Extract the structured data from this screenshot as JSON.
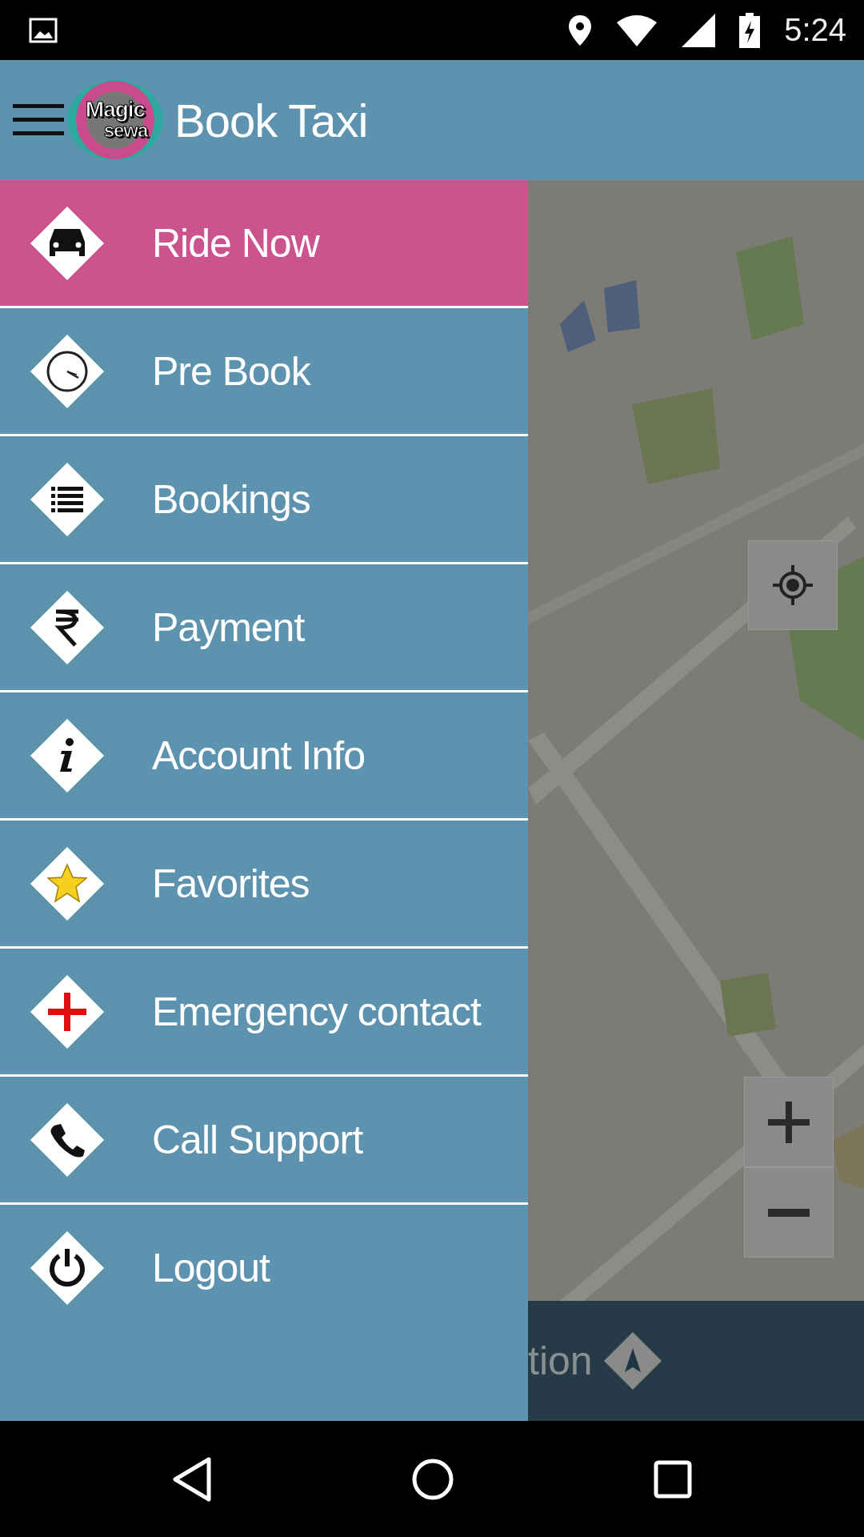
{
  "status_bar": {
    "time": "5:24"
  },
  "app_bar": {
    "title": "Book Taxi",
    "logo": {
      "line_1": "Magic",
      "line_2": "sewa"
    }
  },
  "drawer": {
    "items": [
      {
        "label": "Ride Now",
        "kind": "car",
        "selected": true
      },
      {
        "label": "Pre Book",
        "kind": "clock",
        "selected": false
      },
      {
        "label": "Bookings",
        "kind": "list",
        "selected": false
      },
      {
        "label": "Payment",
        "kind": "rupee",
        "selected": false
      },
      {
        "label": "Account Info",
        "kind": "info",
        "selected": false
      },
      {
        "label": "Favorites",
        "kind": "star",
        "selected": false
      },
      {
        "label": "Emergency contact",
        "kind": "cross",
        "selected": false
      },
      {
        "label": "Call Support",
        "kind": "phone",
        "selected": false
      },
      {
        "label": "Logout",
        "kind": "power",
        "selected": false
      }
    ]
  },
  "bottom_bar": {
    "text": "tion"
  }
}
